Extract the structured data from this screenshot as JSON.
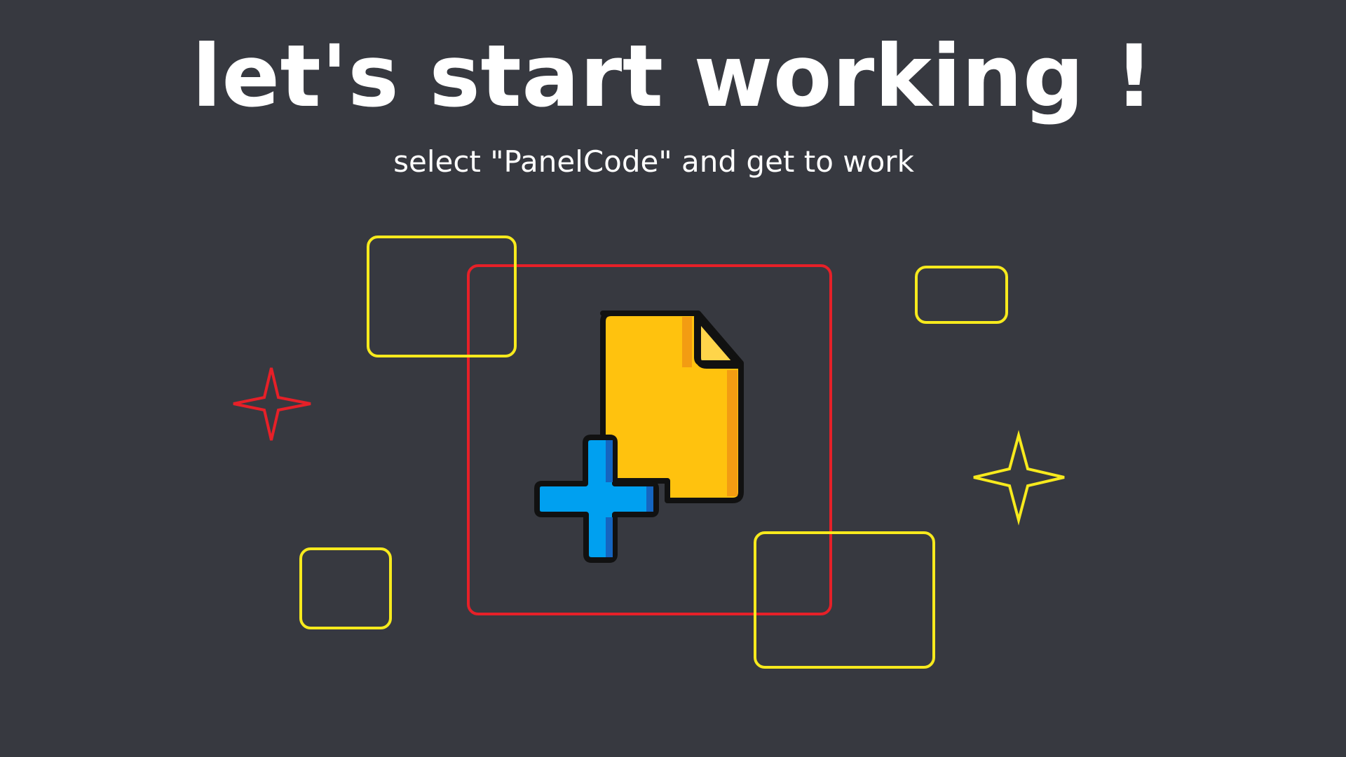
{
  "hero": {
    "title": "let's start working !",
    "subtitle": "select \"PanelCode\" and get to work"
  },
  "decorations": {
    "frame_color": "#e62028",
    "outline_color": "#f7ea1d",
    "sparkle_left_color": "#e62028",
    "sparkle_right_color": "#f7ea1d"
  },
  "illustration": {
    "icon": "new-file-plus-icon",
    "file_color": "#ffc20e",
    "file_shade_color": "#f39c12",
    "fold_color": "#ffd54a",
    "plus_color": "#00a0f0",
    "plus_shade_color": "#1565c0",
    "outline_color": "#111111"
  }
}
